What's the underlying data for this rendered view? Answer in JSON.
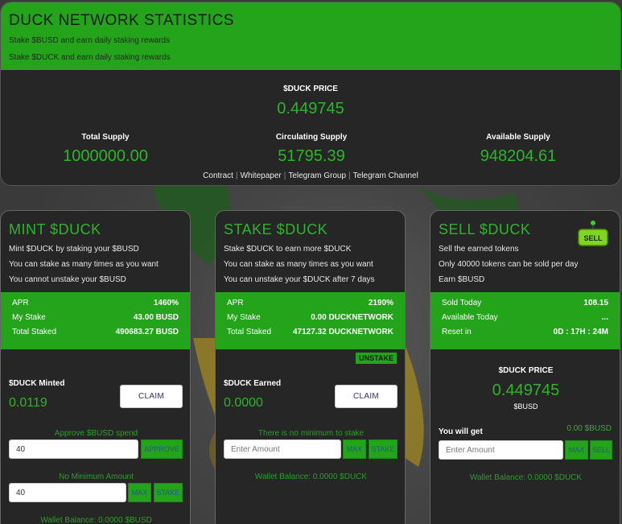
{
  "header": {
    "title": "DUCK NETWORK STATISTICS",
    "subtitle1": "Stake $BUSD and earn daily staking rewards",
    "subtitle2": "Stake $DUCK and earn daily staking rewards",
    "price_label": "$DUCK PRICE",
    "price_value": "0.449745",
    "total_supply_label": "Total Supply",
    "total_supply_value": "1000000.00",
    "circulating_label": "Circulating Supply",
    "circulating_value": "51795.39",
    "available_label": "Available Supply",
    "available_value": "948204.61",
    "links": [
      "Contract",
      "Whitepaper",
      "Telegram Group",
      "Telegram Channel"
    ]
  },
  "mint": {
    "title": "MINT $DUCK",
    "desc": [
      "Mint $DUCK by staking your $BUSD",
      "You can stake as many times as you want",
      "You cannot unstake your $BUSD"
    ],
    "stats": [
      {
        "label": "APR",
        "value": "1460%"
      },
      {
        "label": "My Stake",
        "value": "43.00 BUSD"
      },
      {
        "label": "Total Staked",
        "value": "490683.27 BUSD"
      }
    ],
    "earned_label": "$DUCK Minted",
    "earned_value": "0.0119",
    "claim_label": "CLAIM",
    "approve_text": "Approve $BUSD spend",
    "approve_input": "40",
    "approve_button": "APPROVE",
    "min_text": "No Minimum Amount",
    "stake_input": "40",
    "max_button": "MAX",
    "stake_button": "STAKE",
    "wallet": "Wallet Balance: 0.0000 $BUSD"
  },
  "stake": {
    "title": "STAKE $DUCK",
    "desc": [
      "Stake $DUCK to earn more $DUCK",
      "You can stake as many times as you want",
      "You can unstake your $DUCK after 7 days"
    ],
    "stats": [
      {
        "label": "APR",
        "value": "2190%"
      },
      {
        "label": "My Stake",
        "value": "0.00 DUCKNETWORK"
      },
      {
        "label": "Total Staked",
        "value": "47127.32 DUCKNETWORK"
      }
    ],
    "unstake_button": "UNSTAKE",
    "earned_label": "$DUCK Earned",
    "earned_value": "0.0000",
    "claim_label": "CLAIM",
    "min_text": "There is no minimum to stake",
    "input_placeholder": "Enter Amount",
    "max_button": "MAX",
    "stake_button": "STAKE",
    "wallet": "Wallet Balance: 0.0000 $DUCK"
  },
  "sell": {
    "title": "SELL $DUCK",
    "icon_label": "SELL",
    "desc": [
      "Sell the earned tokens",
      "Only 40000 tokens can be sold per day",
      "Earn $BUSD"
    ],
    "stats": [
      {
        "label": "Sold Today",
        "value": "108.15"
      },
      {
        "label": "Available Today",
        "value": "..."
      },
      {
        "label": "Reset in",
        "value": "0D : 17H : 24M"
      }
    ],
    "price_label": "$DUCK PRICE",
    "price_value": "0.449745",
    "price_unit": "$BUSD",
    "get_label": "You will get",
    "get_value": "0.00 $BUSD",
    "input_placeholder": "Enter Amount",
    "max_button": "MAX",
    "sell_button": "SELL",
    "wallet": "Wallet Balance: 0.0000 $DUCK"
  },
  "colors": {
    "accent": "#23a41a",
    "accent_text": "#2db52a",
    "panel": "#262626"
  }
}
